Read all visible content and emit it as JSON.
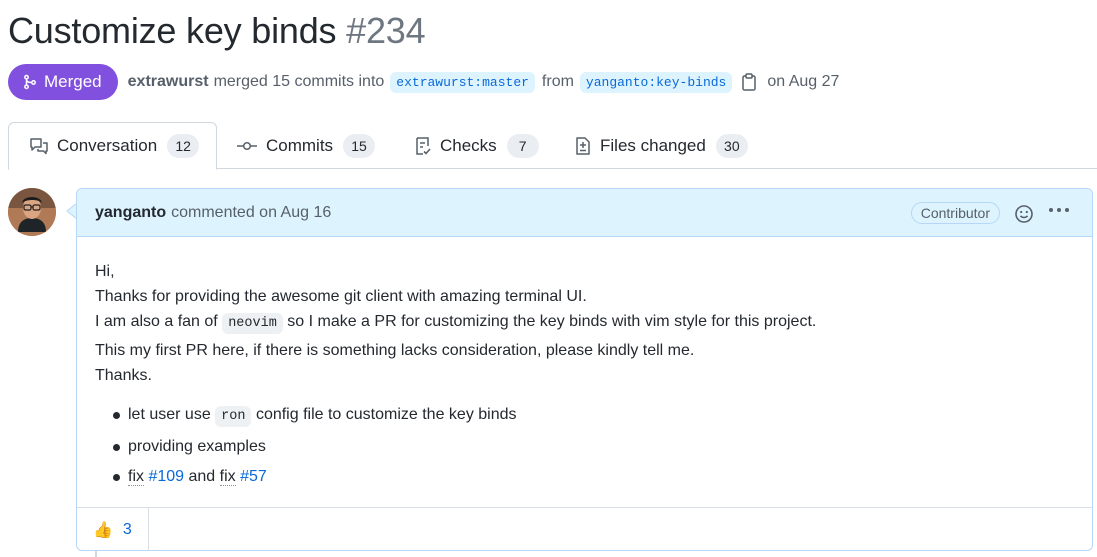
{
  "pr": {
    "title": "Customize key binds",
    "number": "#234",
    "state": "Merged",
    "author": "extrawurst",
    "action_text": "merged 15 commits into",
    "base_branch": "extrawurst:master",
    "from_text": "from",
    "head_branch": "yanganto:key-binds",
    "date_text": "on Aug 27"
  },
  "tabs": [
    {
      "label": "Conversation",
      "count": "12",
      "icon": "comment-discussion-icon"
    },
    {
      "label": "Commits",
      "count": "15",
      "icon": "git-commit-icon"
    },
    {
      "label": "Checks",
      "count": "7",
      "icon": "checklist-icon"
    },
    {
      "label": "Files changed",
      "count": "30",
      "icon": "file-diff-icon"
    }
  ],
  "comment": {
    "user": "yanganto",
    "meta": "commented on Aug 16",
    "role_badge": "Contributor",
    "lines": {
      "greeting": "Hi,",
      "thanks": "Thanks for providing the awesome git client with amazing terminal UI.",
      "fan_before": "I am also a fan of",
      "fan_code": "neovim",
      "fan_after": "so I make a PR for customizing the key binds with vim style for this project.",
      "first_pr": "This my first PR here, if there is something lacks consideration, please kindly tell me.",
      "closing": "Thanks."
    },
    "bullets": {
      "b1_before": "let user use",
      "b1_code": "ron",
      "b1_after": "config file to customize the key binds",
      "b2": "providing examples",
      "b3_fix1": "fix",
      "b3_link1": "#109",
      "b3_mid": "and",
      "b3_fix2": "fix",
      "b3_link2": "#57"
    },
    "reaction": {
      "emoji": "👍",
      "count": "3"
    }
  },
  "colors": {
    "merged": "#8250df",
    "link": "#0969da",
    "header_bg": "#ddf4ff",
    "border": "#d0d7de"
  }
}
